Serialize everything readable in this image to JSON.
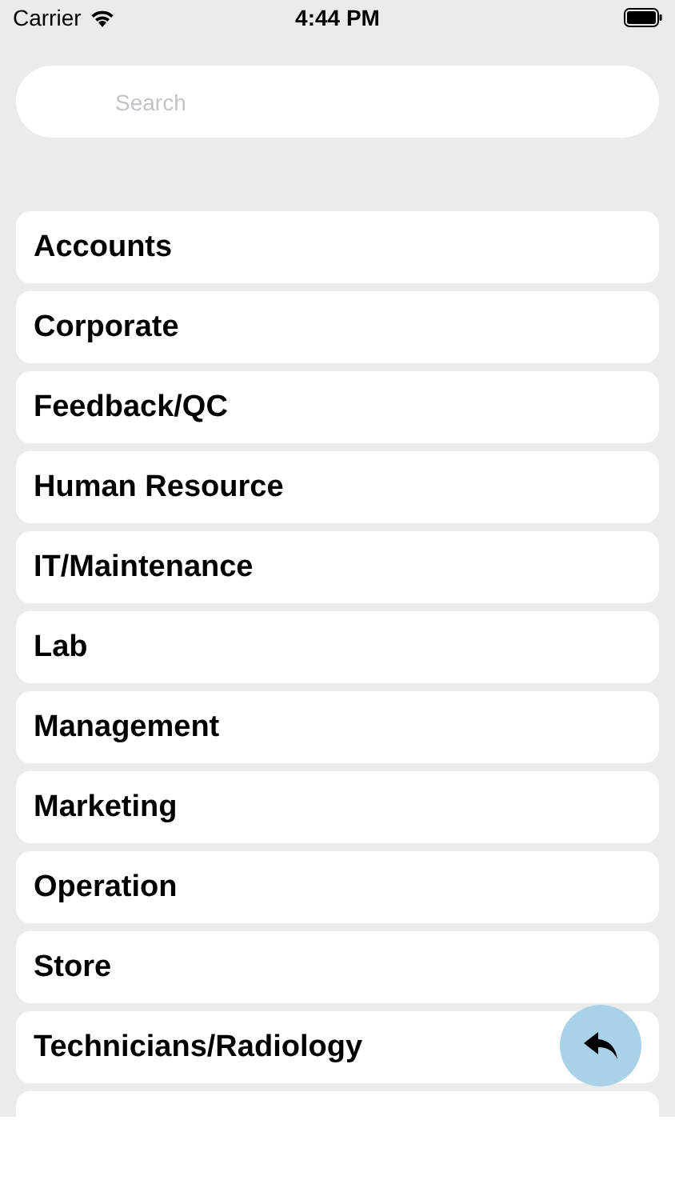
{
  "status_bar": {
    "carrier": "Carrier",
    "time": "4:44 PM"
  },
  "search": {
    "placeholder": "Search"
  },
  "departments": [
    {
      "kind": "item",
      "label": "Accounts"
    },
    {
      "kind": "item",
      "label": "Corporate"
    },
    {
      "kind": "item",
      "label": "Feedback/QC"
    },
    {
      "kind": "item",
      "label": "Human Resource"
    },
    {
      "kind": "item",
      "label": "IT/Maintenance"
    },
    {
      "kind": "item",
      "label": "Lab"
    },
    {
      "kind": "item",
      "label": "Management"
    },
    {
      "kind": "item",
      "label": "Marketing"
    },
    {
      "kind": "item",
      "label": "Operation"
    },
    {
      "kind": "item",
      "label": "Store"
    },
    {
      "kind": "item",
      "label": "Technicians/Radiology"
    },
    {
      "kind": "cut_off"
    }
  ]
}
